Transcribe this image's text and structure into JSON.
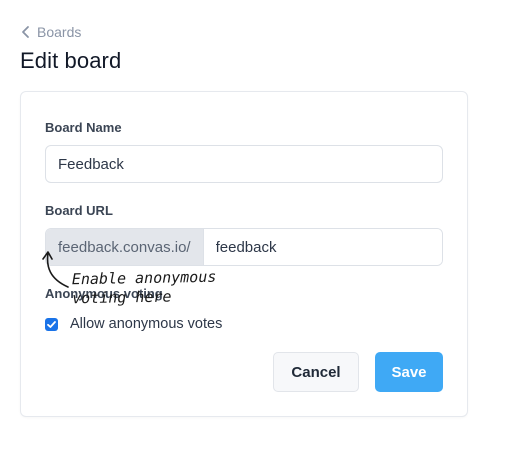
{
  "breadcrumb": {
    "label": "Boards",
    "icon": "chevron-left-icon"
  },
  "page": {
    "title": "Edit board"
  },
  "form": {
    "board_name": {
      "label": "Board Name",
      "value": "Feedback"
    },
    "board_url": {
      "label": "Board URL",
      "prefix": "feedback.convas.io/",
      "value": "feedback"
    },
    "anonymous_voting": {
      "label": "Anonymous voting",
      "checkbox_label": "Allow anonymous votes",
      "checked": true
    }
  },
  "actions": {
    "cancel_label": "Cancel",
    "save_label": "Save"
  },
  "annotation": {
    "line1": "Enable anonymous",
    "line2": "voting here"
  },
  "colors": {
    "accent": "#3fa9f5",
    "checkbox": "#1a73e8",
    "muted": "#8a94a6"
  }
}
